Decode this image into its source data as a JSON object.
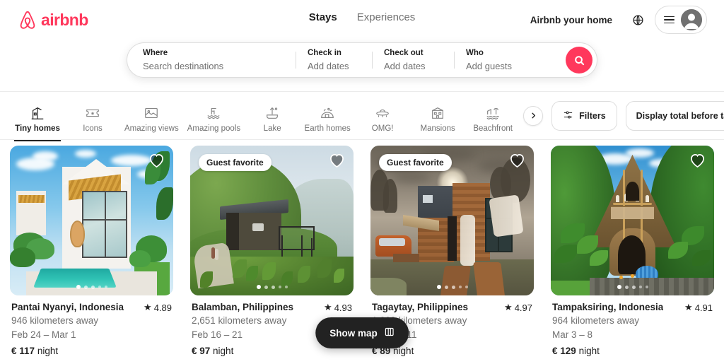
{
  "brand": {
    "name": "airbnb",
    "color": "#FF385C",
    "logo_icon": "airbnb-belo-logo"
  },
  "header": {
    "nav": [
      {
        "label": "Stays",
        "active": true
      },
      {
        "label": "Experiences",
        "active": false
      }
    ],
    "host_link": "Airbnb your home",
    "globe_icon": "globe-icon",
    "menu_icon": "hamburger-icon",
    "avatar_icon": "user-avatar-icon"
  },
  "search": {
    "where": {
      "label": "Where",
      "placeholder": "Search destinations",
      "value": ""
    },
    "checkin": {
      "label": "Check in",
      "value": "Add dates"
    },
    "checkout": {
      "label": "Check out",
      "value": "Add dates"
    },
    "who": {
      "label": "Who",
      "value": "Add guests"
    },
    "search_icon": "search-icon"
  },
  "categories": [
    {
      "label": "Tiny homes",
      "icon": "tiny-home-icon",
      "active": true
    },
    {
      "label": "Icons",
      "icon": "ticket-star-icon",
      "active": false
    },
    {
      "label": "Amazing views",
      "icon": "amazing-views-icon",
      "active": false
    },
    {
      "label": "Amazing pools",
      "icon": "pool-icon",
      "active": false
    },
    {
      "label": "Lake",
      "icon": "lake-icon",
      "active": false
    },
    {
      "label": "Earth homes",
      "icon": "earth-home-icon",
      "active": false
    },
    {
      "label": "OMG!",
      "icon": "omg-ufo-icon",
      "active": false
    },
    {
      "label": "Mansions",
      "icon": "mansion-icon",
      "active": false
    },
    {
      "label": "Beachfront",
      "icon": "beachfront-icon",
      "active": false
    }
  ],
  "category_next_icon": "chevron-right-icon",
  "filters": {
    "label": "Filters",
    "icon": "filters-sliders-icon"
  },
  "taxes_toggle": {
    "label": "Display total before taxes",
    "state": "off"
  },
  "show_map": {
    "label": "Show map",
    "icon": "map-icon"
  },
  "listings": [
    {
      "title": "Pantai Nyanyi, Indonesia",
      "distance": "946 kilometers away",
      "dates": "Feb 24 – Mar 1",
      "price": "€ 117",
      "price_unit": "night",
      "rating": "4.89",
      "badge": "",
      "favorite_icon": "heart-icon",
      "photo_alt": "White A-frame villa with glass facade, wooden ceiling, hanging rattan chair and a turquoise pool",
      "dots": 5,
      "active_dot": 1
    },
    {
      "title": "Balamban, Philippines",
      "distance": "2,651 kilometers away",
      "dates": "Feb 16 – 21",
      "price": "€ 97",
      "price_unit": "night",
      "rating": "4.93",
      "badge": "Guest favorite",
      "favorite_icon": "heart-icon",
      "photo_alt": "Dark olive cabin with metal roof and steel deck on a lush green mountainside",
      "dots": 5,
      "active_dot": 1
    },
    {
      "title": "Tagaytay, Philippines",
      "distance": "1,099 kilometers away",
      "dates": "Mar 6 – 11",
      "price": "€ 89",
      "price_unit": "night",
      "rating": "4.97",
      "badge": "Guest favorite",
      "favorite_icon": "heart-icon",
      "photo_alt": "Wood-clad container tiny home under a moody cloudy sky with an orange SUV and wooden chairs",
      "dots": 5,
      "active_dot": 1
    },
    {
      "title": "Tampaksiring, Indonesia",
      "distance": "964 kilometers away",
      "dates": "Mar 3 – 8",
      "price": "€ 129",
      "price_unit": "night",
      "rating": "4.91",
      "badge": "",
      "favorite_icon": "heart-icon",
      "photo_alt": "Bamboo and thatch A-frame treehouse surrounded by tropical jungle",
      "dots": 5,
      "active_dot": 1
    }
  ]
}
